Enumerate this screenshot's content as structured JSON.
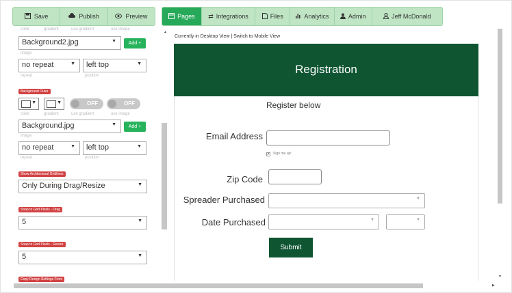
{
  "toolbar": {
    "save": "Save",
    "publish": "Publish",
    "preview": "Preview"
  },
  "nav": {
    "pages": "Pages",
    "integrations": "Integrations",
    "files": "Files",
    "analytics": "Analytics",
    "admin": "Admin",
    "user": "Jeff McDonald"
  },
  "panel": {
    "top_sublabels": [
      "color",
      "gradient",
      "use gradient",
      "use image"
    ],
    "bg_image_1": "Background2.jpg",
    "add_label": "Add +",
    "image_label": "image",
    "repeat_1": "no repeat",
    "position_1": "left top",
    "repeat_label": "repeat",
    "position_label": "position",
    "bg_outer_tag": "Background Outer",
    "toggle_off": "OFF",
    "outer_sublabels": [
      "color",
      "gradient",
      "use gradient",
      "use image"
    ],
    "bg_image_2": "Background.jpg",
    "repeat_2": "no repeat",
    "position_2": "left top",
    "gridlines_tag": "Show Architectural Gridlines",
    "gridlines_value": "Only During Drag/Resize",
    "snap_drag_tag": "Snap to Grid Pixels - Drag",
    "snap_drag_value": "5",
    "snap_resize_tag": "Snap to Grid Pixels - Resize",
    "snap_resize_value": "5",
    "copy_tag": "Copy Design Settings From"
  },
  "view": {
    "current": "Currently in Desktop View",
    "sep": "|",
    "switch": "Switch to Mobile View"
  },
  "form": {
    "title": "Registration",
    "subtitle": "Register below",
    "email_label": "Email Address",
    "signup_label": "Sign me up!",
    "zip_label": "Zip Code",
    "spreader_label": "Spreader Purchased",
    "date_label": "Date Purchased",
    "submit": "Submit"
  },
  "colors": {
    "accent": "#27a95a",
    "header_bg": "#0f5532",
    "tag_red": "#d24242"
  }
}
